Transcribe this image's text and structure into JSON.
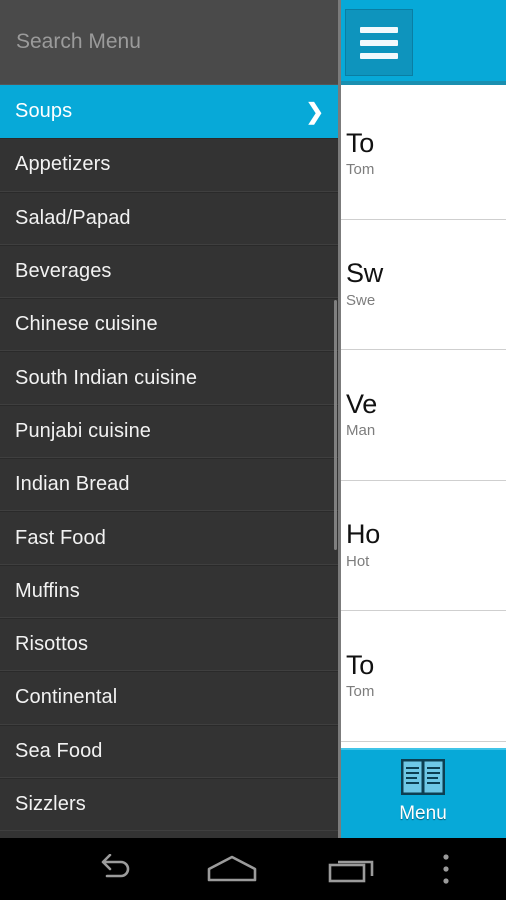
{
  "app": {
    "header": {
      "background_color": "#07a9d8",
      "hamburger_icon": "hamburger-menu-icon"
    }
  },
  "drawer": {
    "search": {
      "placeholder": "Search Menu",
      "value": ""
    },
    "items": [
      {
        "label": "Soups",
        "selected": true,
        "chevron": "❯"
      },
      {
        "label": "Appetizers",
        "selected": false,
        "chevron": "❯"
      },
      {
        "label": "Salad/Papad",
        "selected": false,
        "chevron": "❯"
      },
      {
        "label": "Beverages",
        "selected": false,
        "chevron": "❯"
      },
      {
        "label": "Chinese cuisine",
        "selected": false,
        "chevron": "❯"
      },
      {
        "label": "South Indian cuisine",
        "selected": false,
        "chevron": "❯"
      },
      {
        "label": "Punjabi cuisine",
        "selected": false,
        "chevron": "❯"
      },
      {
        "label": "Indian Bread",
        "selected": false,
        "chevron": "❯"
      },
      {
        "label": "Fast Food",
        "selected": false,
        "chevron": "❯"
      },
      {
        "label": "Muffins",
        "selected": false,
        "chevron": "❯"
      },
      {
        "label": "Risottos",
        "selected": false,
        "chevron": "❯"
      },
      {
        "label": "Continental",
        "selected": false,
        "chevron": "❯"
      },
      {
        "label": "Sea Food",
        "selected": false,
        "chevron": "❯"
      },
      {
        "label": "Sizzlers",
        "selected": false,
        "chevron": "❯"
      }
    ],
    "accent_color": "#07a9d8",
    "background_color": "#333333"
  },
  "menu_list": {
    "items": [
      {
        "title": "To",
        "subtitle": "Tom",
        "thumb": "tomato-soup-photo"
      },
      {
        "title": "Sw",
        "subtitle": "Swe",
        "thumb": "sweet-corn-soup-photo"
      },
      {
        "title": "Ve",
        "subtitle": "Man",
        "thumb": "veg-manchow-soup-photo"
      },
      {
        "title": "Ho",
        "subtitle": "Hot",
        "thumb": "hot-and-sour-soup-photo"
      },
      {
        "title": "To",
        "subtitle": "Tom",
        "thumb": "tom-yum-soup-photo"
      }
    ]
  },
  "tab_bar": {
    "tabs": [
      {
        "label": "Menu",
        "icon": "open-book-icon",
        "active": true
      }
    ],
    "background_color": "#07a9d8"
  },
  "nav_bar": {
    "buttons": [
      {
        "name": "back",
        "icon": "back-arrow-icon"
      },
      {
        "name": "home",
        "icon": "home-icon"
      },
      {
        "name": "recents",
        "icon": "recent-apps-icon"
      },
      {
        "name": "overflow",
        "icon": "overflow-menu-icon"
      }
    ],
    "background_color": "#000000"
  }
}
